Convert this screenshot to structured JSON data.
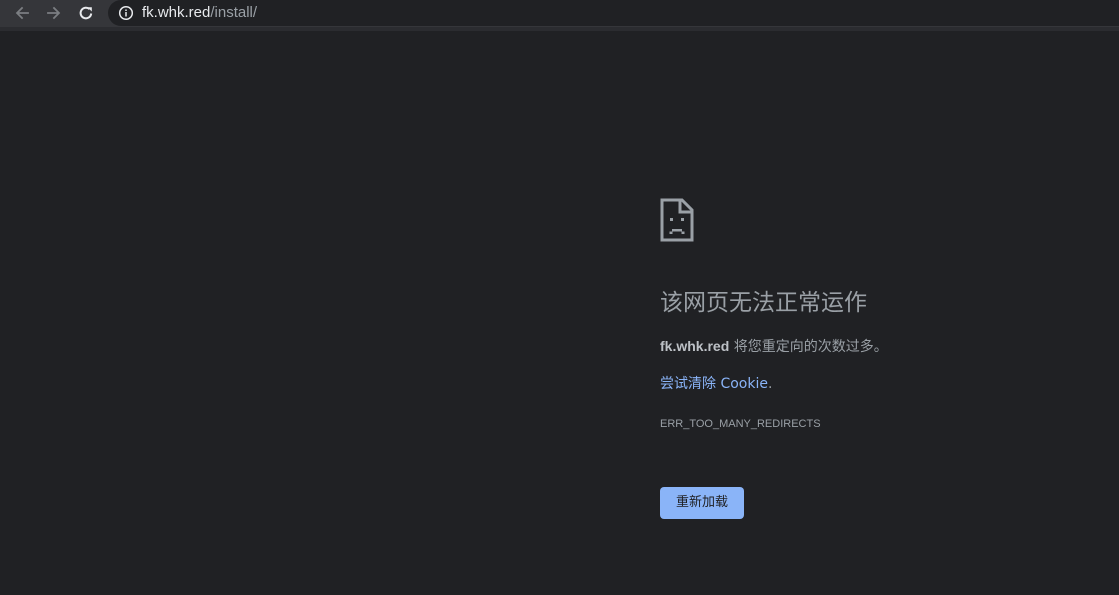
{
  "browser": {
    "back_icon": "arrow-left-icon",
    "forward_icon": "arrow-right-icon",
    "reload_icon": "reload-icon",
    "site_info_icon": "info-circle-icon",
    "url_host": "fk.whk.red",
    "url_path": "/install/"
  },
  "error_page": {
    "icon": "sad-page-icon",
    "headline": "该网页无法正常运作",
    "message_host": "fk.whk.red",
    "message_text": " 将您重定向的次数过多。",
    "suggestion_link": "尝试清除 Cookie",
    "suggestion_suffix": ".",
    "error_code": "ERR_TOO_MANY_REDIRECTS",
    "reload_button_label": "重新加载"
  },
  "colors": {
    "page_background": "#202124",
    "toolbar_background": "#35363a",
    "link_color": "#8ab4f8",
    "button_background": "#8ab4f8",
    "secondary_text": "#9aa0a6"
  }
}
